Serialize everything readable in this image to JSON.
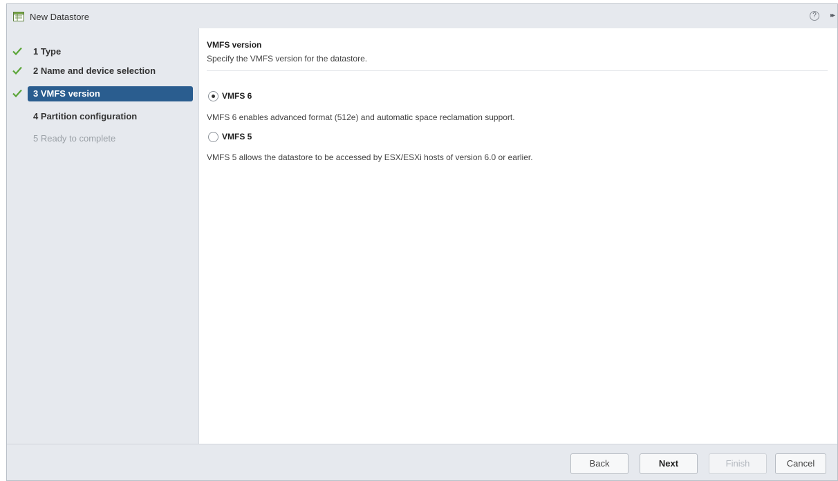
{
  "window": {
    "title": "New Datastore",
    "help_glyph": "?",
    "expand_glyph": "▸▸"
  },
  "steps": [
    {
      "label": "1 Type",
      "status": "complete"
    },
    {
      "label": "2 Name and device selection",
      "status": "complete"
    },
    {
      "label": "3 VMFS version",
      "status": "current"
    },
    {
      "label": "4 Partition configuration",
      "status": "pending"
    },
    {
      "label": "5 Ready to complete",
      "status": "disabled"
    }
  ],
  "content": {
    "title": "VMFS version",
    "subtitle": "Specify the VMFS version for the datastore.",
    "options": [
      {
        "label": "VMFS 6",
        "description": "VMFS 6 enables advanced format (512e) and automatic space reclamation support.",
        "selected": true
      },
      {
        "label": "VMFS 5",
        "description": "VMFS 5 allows the datastore to be accessed by ESX/ESXi hosts of version 6.0 or earlier.",
        "selected": false
      }
    ]
  },
  "buttons": {
    "back": "Back",
    "next": "Next",
    "finish": "Finish",
    "cancel": "Cancel"
  },
  "colors": {
    "active_step": "#2a5d8f",
    "check": "#5aa537",
    "panel": "#e6e9ee"
  },
  "icons": {
    "title": "datastore-icon",
    "help": "help-icon",
    "expand": "expand-icon",
    "step_done": "checkmark-icon"
  }
}
